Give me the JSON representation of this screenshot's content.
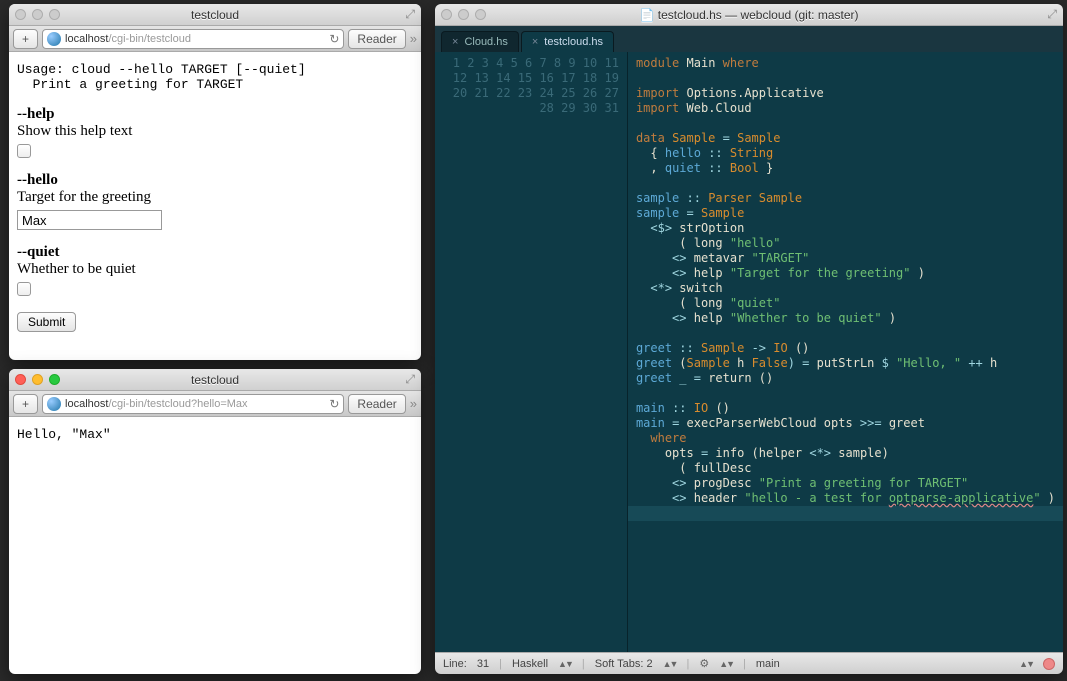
{
  "browser1": {
    "title": "testcloud",
    "back_label": "+",
    "url_host": "localhost",
    "url_path": "/cgi-bin/testcloud",
    "reader_label": "Reader",
    "usage_line1": "Usage: cloud --hello TARGET [--quiet]",
    "usage_line2": "  Print a greeting for TARGET",
    "opt_help_name": "--help",
    "opt_help_desc": "Show this help text",
    "opt_hello_name": "--hello",
    "opt_hello_desc": "Target for the greeting",
    "opt_hello_value": "Max",
    "opt_quiet_name": "--quiet",
    "opt_quiet_desc": "Whether to be quiet",
    "submit_label": "Submit"
  },
  "browser2": {
    "title": "testcloud",
    "back_label": "+",
    "url_host": "localhost",
    "url_path": "/cgi-bin/testcloud?hello=Max",
    "reader_label": "Reader",
    "body": "Hello, \"Max\""
  },
  "editor": {
    "title": "testcloud.hs — webcloud (git: master)",
    "tab1": "Cloud.hs",
    "tab2": "testcloud.hs",
    "status_line_label": "Line:",
    "status_line_value": "31",
    "status_lang": "Haskell",
    "status_tabs": "Soft Tabs:  2",
    "status_branch": "main",
    "code": {
      "l1": {
        "a": "module ",
        "b": "Main ",
        "c": "where"
      },
      "l3": {
        "a": "import ",
        "b": "Options.Applicative"
      },
      "l4": {
        "a": "import ",
        "b": "Web.Cloud"
      },
      "l6": {
        "a": "data ",
        "b": "Sample ",
        "c": "= ",
        "d": "Sample"
      },
      "l7": {
        "a": "  { ",
        "b": "hello ",
        "c": ":: ",
        "d": "String"
      },
      "l8": {
        "a": "  , ",
        "b": "quiet ",
        "c": ":: ",
        "d": "Bool ",
        "e": "}"
      },
      "l10": {
        "a": "sample ",
        "b": ":: ",
        "c": "Parser Sample"
      },
      "l11": {
        "a": "sample ",
        "b": "= ",
        "c": "Sample"
      },
      "l12": {
        "a": "  <$> ",
        "b": "strOption"
      },
      "l13": {
        "a": "      ( ",
        "b": "long ",
        "c": "\"hello\""
      },
      "l14": {
        "a": "     <> ",
        "b": "metavar ",
        "c": "\"TARGET\""
      },
      "l15": {
        "a": "     <> ",
        "b": "help ",
        "c": "\"Target for the greeting\" ",
        "d": ")"
      },
      "l16": {
        "a": "  <*> ",
        "b": "switch"
      },
      "l17": {
        "a": "      ( ",
        "b": "long ",
        "c": "\"quiet\""
      },
      "l18": {
        "a": "     <> ",
        "b": "help ",
        "c": "\"Whether to be quiet\" ",
        "d": ")"
      },
      "l20": {
        "a": "greet ",
        "b": ":: ",
        "c": "Sample ",
        "d": "-> ",
        "e": "IO ",
        "f": "()"
      },
      "l21": {
        "a": "greet ",
        "b": "(",
        "c": "Sample ",
        "d": "h ",
        "e": "False",
        "f": ") = ",
        "g": "putStrLn ",
        "h": "$ ",
        "i": "\"Hello, \" ",
        "j": "++ ",
        "k": "h"
      },
      "l22": {
        "a": "greet ",
        "b": "_ = ",
        "c": "return ",
        "d": "()"
      },
      "l24": {
        "a": "main ",
        "b": ":: ",
        "c": "IO ",
        "d": "()"
      },
      "l25": {
        "a": "main ",
        "b": "= ",
        "c": "execParserWebCloud opts ",
        "d": ">>= ",
        "e": "greet"
      },
      "l26": {
        "a": "  where"
      },
      "l27": {
        "a": "    opts ",
        "b": "= ",
        "c": "info ",
        "d": "(",
        "e": "helper ",
        "f": "<*> ",
        "g": "sample",
        "h": ")"
      },
      "l28": {
        "a": "      ( ",
        "b": "fullDesc"
      },
      "l29": {
        "a": "     <> ",
        "b": "progDesc ",
        "c": "\"Print a greeting for TARGET\""
      },
      "l30": {
        "a": "     <> ",
        "b": "header ",
        "c": "\"hello - a test for ",
        "d": "optparse-applicative",
        "e": "\" ",
        "f": ")"
      }
    }
  }
}
